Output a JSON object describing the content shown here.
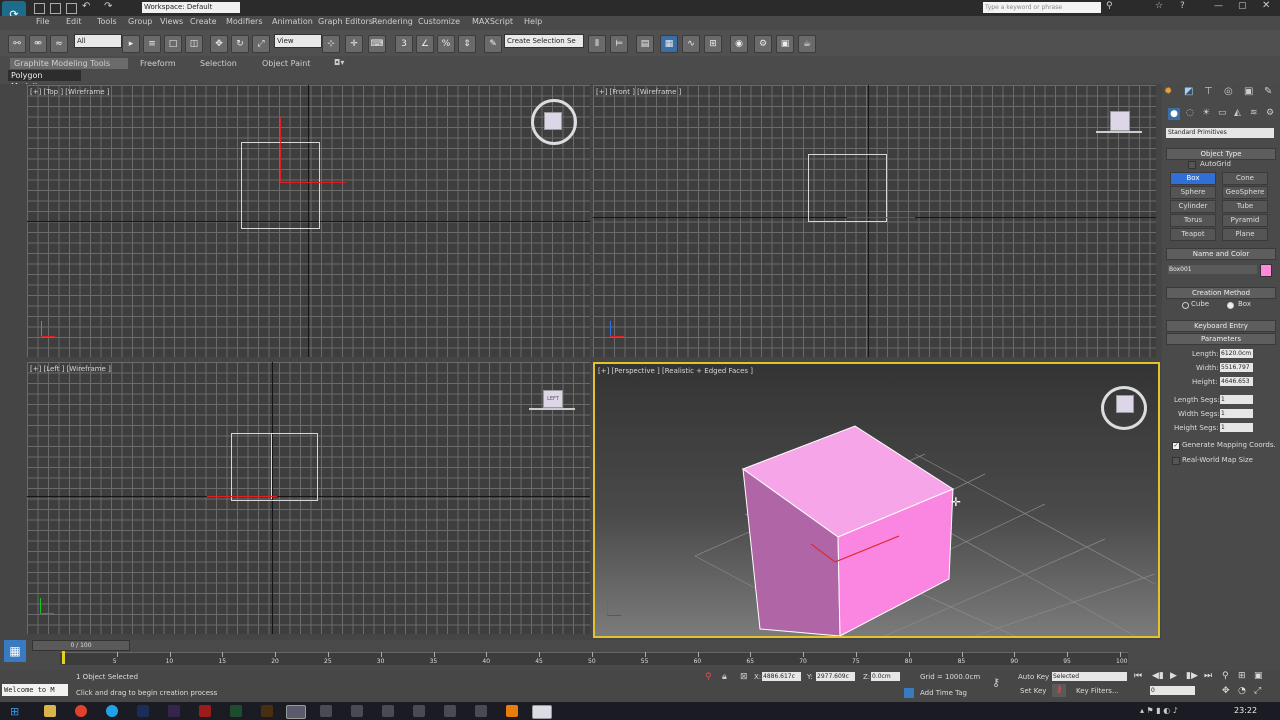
{
  "title_bar": {
    "workspace": "Workspace: Default",
    "search_placeholder": "Type a keyword or phrase"
  },
  "menu": [
    "File",
    "Edit",
    "Tools",
    "Group",
    "Views",
    "Create",
    "Modifiers",
    "Animation",
    "Graph Editors",
    "Rendering",
    "Customize",
    "MAXScript",
    "Help"
  ],
  "main_toolbar": {
    "selection_filter": "All",
    "ref_coord": "View",
    "named_selection": "Create Selection Se"
  },
  "ribbon": {
    "tabs": [
      "Graphite Modeling Tools",
      "Freeform",
      "Selection",
      "Object Paint"
    ],
    "subtab": "Polygon Modeling"
  },
  "viewports": {
    "top": "[+] [Top ] [Wireframe ]",
    "front": "[+] [Front ] [Wireframe ]",
    "left": "[+] [Left ] [Wireframe ]",
    "perspective": "[+] [Perspective ] [Realistic + Edged Faces ]",
    "left_cube_label": "LEFT"
  },
  "command_panel": {
    "category": "Standard Primitives",
    "object_type_header": "Object Type",
    "autogrid": "AutoGrid",
    "buttons": [
      "Box",
      "Cone",
      "Sphere",
      "GeoSphere",
      "Cylinder",
      "Tube",
      "Torus",
      "Pyramid",
      "Teapot",
      "Plane"
    ],
    "name_color_header": "Name and Color",
    "object_name": "Box001",
    "object_color": "#ff88dd",
    "creation_header": "Creation Method",
    "creation_options": [
      "Cube",
      "Box"
    ],
    "keyboard_entry": "Keyboard Entry",
    "parameters_header": "Parameters",
    "length_label": "Length:",
    "length_val": "6120.0cm",
    "width_label": "Width:",
    "width_val": "5516.797",
    "height_label": "Height:",
    "height_val": "4646.653",
    "lsegs_label": "Length Segs:",
    "lsegs_val": "1",
    "wsegs_label": "Width Segs:",
    "wsegs_val": "1",
    "hsegs_label": "Height Segs:",
    "hsegs_val": "1",
    "gen_mapping": "Generate Mapping Coords.",
    "real_world": "Real-World Map Size"
  },
  "timeline": {
    "frame_display": "0 / 100",
    "ticks": [
      "5",
      "10",
      "15",
      "20",
      "25",
      "30",
      "35",
      "40",
      "45",
      "50",
      "55",
      "60",
      "65",
      "70",
      "75",
      "80",
      "85",
      "90",
      "95",
      "100"
    ]
  },
  "status": {
    "welcome": "Welcome to M",
    "selected": "1 Object Selected",
    "prompt": "Click and drag to begin creation process",
    "x_label": "X:",
    "x_val": "4886.617c",
    "y_label": "Y:",
    "y_val": "2977.609c",
    "z_label": "Z:",
    "z_val": "0.0cm",
    "grid": "Grid = 1000.0cm",
    "add_time_tag": "Add Time Tag",
    "auto_key": "Auto Key",
    "set_key": "Set Key",
    "key_mode": "Selected",
    "key_filters": "Key Filters...",
    "frame_field": "0"
  },
  "taskbar": {
    "time": "23:22"
  }
}
